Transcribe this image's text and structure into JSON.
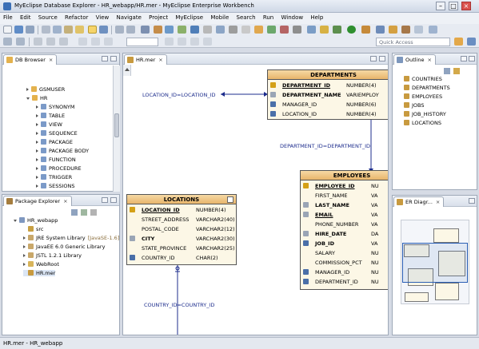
{
  "window": {
    "title": "MyEclipse Database Explorer - HR_webapp/HR.mer - MyEclipse Enterprise Workbench"
  },
  "menu": [
    "File",
    "Edit",
    "Source",
    "Refactor",
    "View",
    "Navigate",
    "Project",
    "MyEclipse",
    "Mobile",
    "Search",
    "Run",
    "Window",
    "Help"
  ],
  "quick_access": {
    "placeholder": "Quick Access"
  },
  "db_browser": {
    "tab": "DB Browser",
    "items": [
      {
        "label": "GSMUSER",
        "level": 0,
        "expander": "closed"
      },
      {
        "label": "HR",
        "level": 0,
        "expander": "open"
      },
      {
        "label": "SYNONYM",
        "level": 1,
        "expander": "closed"
      },
      {
        "label": "TABLE",
        "level": 1,
        "expander": "closed"
      },
      {
        "label": "VIEW",
        "level": 1,
        "expander": "closed"
      },
      {
        "label": "SEQUENCE",
        "level": 1,
        "expander": "closed"
      },
      {
        "label": "PACKAGE",
        "level": 1,
        "expander": "closed"
      },
      {
        "label": "PACKAGE BODY",
        "level": 1,
        "expander": "closed"
      },
      {
        "label": "FUNCTION",
        "level": 1,
        "expander": "closed"
      },
      {
        "label": "PROCEDURE",
        "level": 1,
        "expander": "closed"
      },
      {
        "label": "TRIGGER",
        "level": 1,
        "expander": "closed"
      },
      {
        "label": "SESSIONS",
        "level": 1,
        "expander": "closed"
      }
    ]
  },
  "package_explorer": {
    "tab": "Package Explorer",
    "items": [
      {
        "label": "HR_webapp",
        "level": 0,
        "expander": "open"
      },
      {
        "label": "src",
        "level": 1,
        "expander": "none"
      },
      {
        "label": "JRE System Library",
        "suffix": "[JavaSE-1.6]",
        "level": 1,
        "expander": "closed"
      },
      {
        "label": "JavaEE 6.0 Generic Library",
        "level": 1,
        "expander": "closed"
      },
      {
        "label": "JSTL 1.2.1 Library",
        "level": 1,
        "expander": "closed"
      },
      {
        "label": "WebRoot",
        "level": 1,
        "expander": "closed"
      },
      {
        "label": "HR.mer",
        "level": 1,
        "expander": "none"
      }
    ]
  },
  "editor": {
    "tab": "HR.mer",
    "relations": {
      "loc_dep": "LOCATION_ID=LOCATION_ID",
      "dep_emp": "DEPARTMENT_ID=DEPARTMENT_ID",
      "country_loc": "COUNTRY_ID=COUNTRY_ID"
    },
    "departments": {
      "name": "DEPARTMENTS",
      "columns": [
        {
          "name": "DEPARTMENT_ID",
          "type": "NUMBER(4)",
          "key": "pk"
        },
        {
          "name": "DEPARTMENT_NAME",
          "type": "VARIEMPLOY",
          "key": "nn"
        },
        {
          "name": "MANAGER_ID",
          "type": "NUMBER(6)",
          "key": "fk"
        },
        {
          "name": "LOCATION_ID",
          "type": "NUMBER(4)",
          "key": "fk"
        }
      ]
    },
    "locations": {
      "name": "LOCATIONS",
      "columns": [
        {
          "name": "LOCATION_ID",
          "type": "NUMBER(4)",
          "key": "pk"
        },
        {
          "name": "STREET_ADDRESS",
          "type": "VARCHAR2(40)",
          "key": ""
        },
        {
          "name": "POSTAL_CODE",
          "type": "VARCHAR2(12)",
          "key": ""
        },
        {
          "name": "CITY",
          "type": "VARCHAR2(30)",
          "key": "nn"
        },
        {
          "name": "STATE_PROVINCE",
          "type": "VARCHAR2(25)",
          "key": ""
        },
        {
          "name": "COUNTRY_ID",
          "type": "CHAR(2)",
          "key": "fk"
        }
      ]
    },
    "employees": {
      "name": "EMPLOYEES",
      "columns": [
        {
          "name": "EMPLOYEE_ID",
          "type": "NU",
          "key": "pk"
        },
        {
          "name": "FIRST_NAME",
          "type": "VA",
          "key": ""
        },
        {
          "name": "LAST_NAME",
          "type": "VA",
          "key": "nn"
        },
        {
          "name": "EMAIL",
          "type": "VA",
          "key": "nnu"
        },
        {
          "name": "PHONE_NUMBER",
          "type": "VA",
          "key": ""
        },
        {
          "name": "HIRE_DATE",
          "type": "DA",
          "key": "nn"
        },
        {
          "name": "JOB_ID",
          "type": "VA",
          "key": "fknn"
        },
        {
          "name": "SALARY",
          "type": "NU",
          "key": ""
        },
        {
          "name": "COMMISSION_PCT",
          "type": "NU",
          "key": ""
        },
        {
          "name": "MANAGER_ID",
          "type": "NU",
          "key": "fk"
        },
        {
          "name": "DEPARTMENT_ID",
          "type": "NU",
          "key": "fk"
        }
      ]
    }
  },
  "outline": {
    "tab": "Outline",
    "items": [
      "COUNTRIES",
      "DEPARTMENTS",
      "EMPLOYEES",
      "JOBS",
      "JOB_HISTORY",
      "LOCATIONS"
    ]
  },
  "er_diagram": {
    "tab": "ER Diagr..."
  },
  "status": {
    "text": "HR.mer - HR_webapp"
  },
  "colors": {
    "entity_header": "#e8b56b",
    "entity_body": "#fcf7e6",
    "relation_text": "#1c2c8c",
    "pk_icon": "#d4a017",
    "fk_icon": "#4a6fa8"
  }
}
